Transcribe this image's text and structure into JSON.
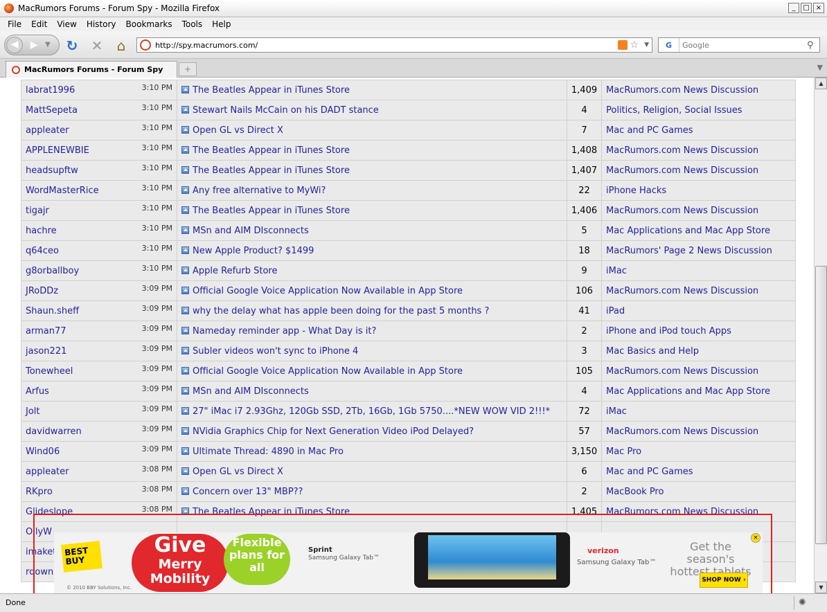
{
  "window": {
    "title": "MacRumors Forums - Forum Spy - Mozilla Firefox",
    "controls": {
      "minimize": "_",
      "maximize": "□",
      "close": "×"
    }
  },
  "menu": [
    "File",
    "Edit",
    "View",
    "History",
    "Bookmarks",
    "Tools",
    "Help"
  ],
  "navbar": {
    "url": "http://spy.macrumors.com/",
    "search_placeholder": "Google",
    "search_engine": "G"
  },
  "tabs": [
    {
      "title": "MacRumors Forums - Forum Spy"
    }
  ],
  "posts": [
    {
      "user": "labrat1996",
      "time": "3:10 PM",
      "thread": "The Beatles Appear in iTunes Store",
      "replies": "1,409",
      "forum": "MacRumors.com News Discussion"
    },
    {
      "user": "MattSepeta",
      "time": "3:10 PM",
      "thread": "Stewart Nails McCain on his DADT stance",
      "replies": "4",
      "forum": "Politics, Religion, Social Issues"
    },
    {
      "user": "appleater",
      "time": "3:10 PM",
      "thread": "Open GL vs Direct X",
      "replies": "7",
      "forum": "Mac and PC Games"
    },
    {
      "user": "APPLENEWBIE",
      "time": "3:10 PM",
      "thread": "The Beatles Appear in iTunes Store",
      "replies": "1,408",
      "forum": "MacRumors.com News Discussion"
    },
    {
      "user": "headsupftw",
      "time": "3:10 PM",
      "thread": "The Beatles Appear in iTunes Store",
      "replies": "1,407",
      "forum": "MacRumors.com News Discussion"
    },
    {
      "user": "WordMasterRice",
      "time": "3:10 PM",
      "thread": "Any free alternative to MyWi?",
      "replies": "22",
      "forum": "iPhone Hacks"
    },
    {
      "user": "tigajr",
      "time": "3:10 PM",
      "thread": "The Beatles Appear in iTunes Store",
      "replies": "1,406",
      "forum": "MacRumors.com News Discussion"
    },
    {
      "user": "hachre",
      "time": "3:10 PM",
      "thread": "MSn and AIM DIsconnects",
      "replies": "5",
      "forum": "Mac Applications and Mac App Store"
    },
    {
      "user": "q64ceo",
      "time": "3:10 PM",
      "thread": "New Apple Product? $1499",
      "replies": "18",
      "forum": "MacRumors' Page 2 News Discussion"
    },
    {
      "user": "g8orballboy",
      "time": "3:10 PM",
      "thread": "Apple Refurb Store",
      "replies": "9",
      "forum": "iMac"
    },
    {
      "user": "JRoDDz",
      "time": "3:09 PM",
      "thread": "Official Google Voice Application Now Available in App Store",
      "replies": "106",
      "forum": "MacRumors.com News Discussion"
    },
    {
      "user": "Shaun.sheff",
      "time": "3:09 PM",
      "thread": "why the delay what has apple been doing for the past 5 months ?",
      "replies": "41",
      "forum": "iPad"
    },
    {
      "user": "arman77",
      "time": "3:09 PM",
      "thread": "Nameday reminder app - What Day is it?",
      "replies": "2",
      "forum": "iPhone and iPod touch Apps"
    },
    {
      "user": "jason221",
      "time": "3:09 PM",
      "thread": "Subler videos won't sync to iPhone 4",
      "replies": "3",
      "forum": "Mac Basics and Help"
    },
    {
      "user": "Tonewheel",
      "time": "3:09 PM",
      "thread": "Official Google Voice Application Now Available in App Store",
      "replies": "105",
      "forum": "MacRumors.com News Discussion"
    },
    {
      "user": "Arfus",
      "time": "3:09 PM",
      "thread": "MSn and AIM DIsconnects",
      "replies": "4",
      "forum": "Mac Applications and Mac App Store"
    },
    {
      "user": "Jolt",
      "time": "3:09 PM",
      "thread": "27\" iMac i7 2.93Ghz, 120Gb SSD, 2Tb, 16Gb, 1Gb 5750....*NEW WOW VID 2!!!*",
      "replies": "72",
      "forum": "iMac"
    },
    {
      "user": "davidwarren",
      "time": "3:09 PM",
      "thread": "NVidia Graphics Chip for Next Generation Video iPod Delayed?",
      "replies": "57",
      "forum": "MacRumors.com News Discussion"
    },
    {
      "user": "Wind06",
      "time": "3:09 PM",
      "thread": "Ultimate Thread: 4890 in Mac Pro",
      "replies": "3,150",
      "forum": "Mac Pro"
    },
    {
      "user": "appleater",
      "time": "3:08 PM",
      "thread": "Open GL vs Direct X",
      "replies": "6",
      "forum": "Mac and PC Games"
    },
    {
      "user": "RKpro",
      "time": "3:08 PM",
      "thread": "Concern over 13\" MBP??",
      "replies": "2",
      "forum": "MacBook Pro"
    },
    {
      "user": "Glideslope",
      "time": "3:08 PM",
      "thread": "The Beatles Appear in iTunes Store",
      "replies": "1,405",
      "forum": "MacRumors.com News Discussion"
    },
    {
      "user": "OllyW",
      "time": "",
      "thread": "",
      "replies": "",
      "forum": ""
    },
    {
      "user": "imaket",
      "time": "",
      "thread": "",
      "replies": "",
      "forum": ""
    },
    {
      "user": "rdown",
      "time": "",
      "thread": "",
      "replies": "",
      "forum": ""
    }
  ],
  "ad": {
    "brand": "BEST BUY",
    "headline_1": "Give",
    "headline_2": "Merry",
    "headline_3": "Mobility",
    "bubble": "Flexible plans for all",
    "carrier_1": "Sprint",
    "device_1": "Samsung Galaxy Tab™",
    "carrier_2": "verizon",
    "device_2": "Samsung Galaxy Tab™",
    "tagline": "Get the season's hottest tablets",
    "cta": "SHOP NOW ›",
    "copyright": "© 2010 BBY Solutions, Inc.",
    "close": "×"
  },
  "status": {
    "text": "Done"
  }
}
